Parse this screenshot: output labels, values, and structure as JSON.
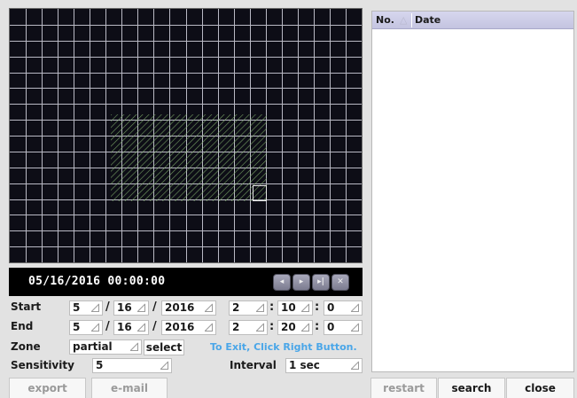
{
  "playback": {
    "timestamp": "05/16/2016 00:00:00",
    "buttons": [
      {
        "name": "rewind-button",
        "icon": "rewind-icon",
        "glyph": "◂"
      },
      {
        "name": "play-button",
        "icon": "play-icon",
        "glyph": "▸"
      },
      {
        "name": "step-forward-button",
        "icon": "step-forward-icon",
        "glyph": "▸|"
      },
      {
        "name": "stop-button",
        "icon": "close-icon",
        "glyph": "✕"
      }
    ]
  },
  "form": {
    "start_label": "Start",
    "end_label": "End",
    "zone_label": "Zone",
    "sensitivity_label": "Sensitivity",
    "interval_label": "Interval",
    "start": {
      "month": "5",
      "day": "16",
      "year": "2016",
      "hour": "2",
      "minute": "10",
      "second": "0"
    },
    "end": {
      "month": "5",
      "day": "16",
      "year": "2016",
      "hour": "2",
      "minute": "20",
      "second": "0"
    },
    "date_sep": "/",
    "time_sep": ":",
    "zone_value": "partial",
    "select_label": "select",
    "hint": "To Exit, Click Right Button.",
    "sensitivity_value": "5",
    "interval_value": "1 sec"
  },
  "list": {
    "col_no": "No.",
    "col_date": "Date"
  },
  "buttons": {
    "export": "export",
    "email": "e-mail",
    "restart": "restart",
    "search": "search",
    "close": "close"
  },
  "colors": {
    "video_bg": "#0d0d16",
    "grid_line": "#b9b9c4",
    "zone_hatch": "#7fae6a",
    "hint": "#4aa6e8"
  }
}
